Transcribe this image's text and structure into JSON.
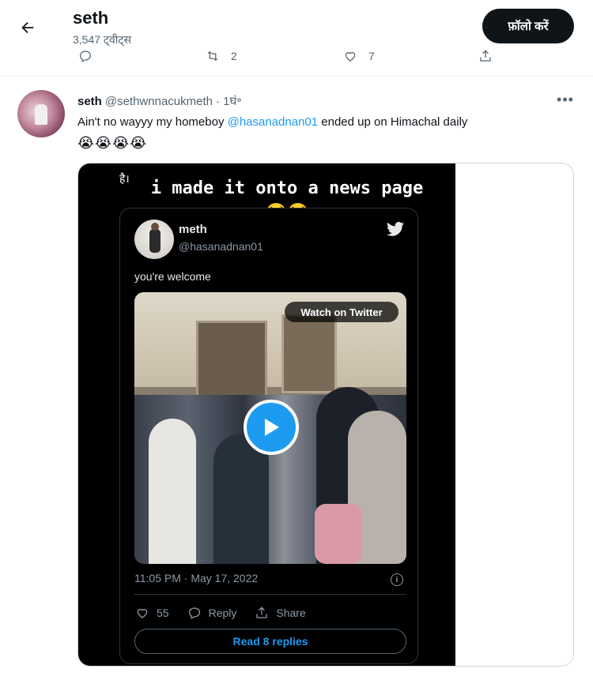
{
  "header": {
    "title": "seth",
    "tweet_count": "3,547 ट्वीट्स",
    "follow_label": "फ़ॉलो करें"
  },
  "prev_actions": {
    "retweets": "2",
    "likes": "7"
  },
  "tweet": {
    "name": "seth",
    "handle": "@sethwnnacukmeth",
    "time": "· 1घं॰",
    "text_before": "Ain't no wayyy my homeboy ",
    "mention": "@hasanadnan01",
    "text_after": " ended up on Himachal daily",
    "emojis": "😭😭😭😭"
  },
  "media": {
    "story_hi": "है।",
    "caption": "i made it onto a news page 😂😂",
    "embed": {
      "name": "meth",
      "handle": "@hasanadnan01",
      "text": "you're welcome",
      "watch_label": "Watch on Twitter",
      "timestamp": "11:05 PM · May 17, 2022",
      "likes": "55",
      "reply_label": "Reply",
      "share_label": "Share",
      "read_replies": "Read 8 replies"
    }
  },
  "colors": {
    "accent": "#1d9bf0",
    "text": "#0f1419",
    "muted": "#536471"
  }
}
